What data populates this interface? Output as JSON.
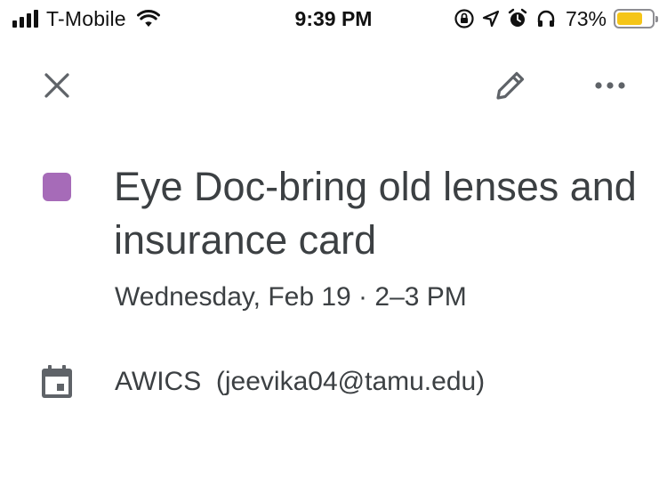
{
  "status_bar": {
    "carrier": "T-Mobile",
    "time": "9:39 PM",
    "battery_percent": "73%",
    "battery_level": 0.73,
    "icons": [
      "signal-icon",
      "wifi-icon",
      "orientation-lock-icon",
      "location-icon",
      "alarm-icon",
      "headphones-icon",
      "battery-icon"
    ]
  },
  "toolbar": {
    "close_icon": "close-icon",
    "edit_icon": "pencil-icon",
    "more_icon": "more-horizontal-icon"
  },
  "event": {
    "color": "#a66bb8",
    "title": "Eye Doc-bring old lenses and insurance card",
    "time": "Wednesday, Feb 19 · 2–3 PM",
    "calendar_icon": "calendar-icon",
    "calendar_name": "AWICS",
    "calendar_account": "(jeevika04@tamu.edu)"
  },
  "colors": {
    "text": "#3c4043",
    "icon": "#5f6368",
    "battery_fill": "#f5c518"
  }
}
